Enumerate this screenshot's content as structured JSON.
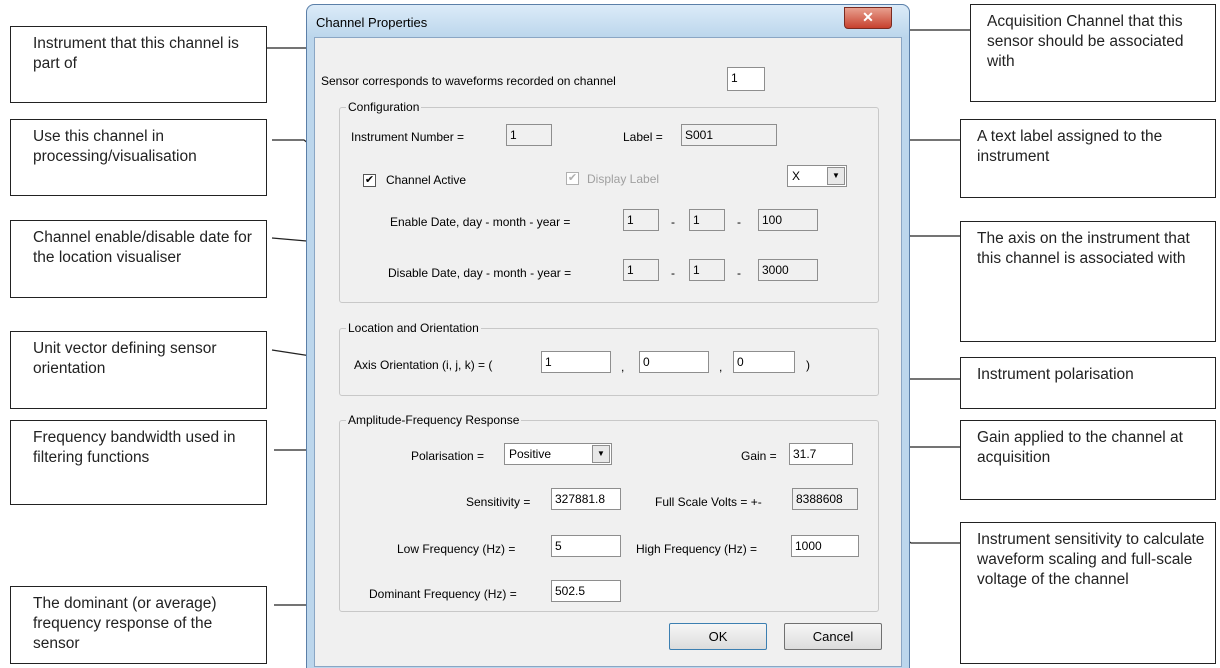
{
  "dialog": {
    "title": "Channel Properties",
    "close_glyph": "✕",
    "sensor_channel_label": "Sensor corresponds to waveforms recorded on channel",
    "sensor_channel_value": "1",
    "configuration": {
      "title": "Configuration",
      "instrument_number_label": "Instrument Number =",
      "instrument_number_value": "1",
      "label_label": "Label =",
      "label_value": "S001",
      "channel_active_label": "Channel Active",
      "channel_active_checked": true,
      "display_label_label": "Display Label",
      "display_label_checked": true,
      "axis_value": "X",
      "enable_date_label": "Enable Date, day - month - year =",
      "enable_day": "1",
      "enable_month": "1",
      "enable_year": "100",
      "disable_date_label": "Disable Date, day - month - year =",
      "disable_day": "1",
      "disable_month": "1",
      "disable_year": "3000",
      "date_sep": "-"
    },
    "location": {
      "title": "Location and Orientation",
      "axis_orientation_label": "Axis Orientation (i, j, k) = (",
      "i": "1",
      "j": "0",
      "k": "0",
      "comma": ",",
      "close_paren": ")"
    },
    "amplitude": {
      "title": "Amplitude-Frequency Response",
      "polarisation_label": "Polarisation =",
      "polarisation_value": "Positive",
      "gain_label": "Gain =",
      "gain_value": "31.7",
      "sensitivity_label": "Sensitivity =",
      "sensitivity_value": "327881.8",
      "full_scale_label": "Full Scale Volts = +-",
      "full_scale_value": "8388608",
      "low_freq_label": "Low Frequency (Hz) =",
      "low_freq_value": "5",
      "high_freq_label": "High Frequency (Hz) =",
      "high_freq_value": "1000",
      "dominant_freq_label": "Dominant Frequency (Hz) =",
      "dominant_freq_value": "502.5"
    },
    "ok_label": "OK",
    "cancel_label": "Cancel"
  },
  "callouts": {
    "instrument": "Instrument that this channel is part of",
    "active": "Use this channel in processing/visualisation",
    "dates": "Channel enable/disable date for the location visualiser",
    "orientation": "Unit vector defining sensor orientation",
    "bandwidth": "Frequency bandwidth used in filtering functions",
    "dominant": "The dominant (or average) frequency response of the sensor",
    "acq_channel": "Acquisition Channel that this sensor should be associated with",
    "text_label": "A text label assigned to the instrument",
    "axis": "The axis on the instrument that this channel is associated with",
    "polarisation": "Instrument polarisation",
    "gain": "Gain applied to the channel at acquisition",
    "sensitivity": "Instrument sensitivity to calculate waveform scaling and full-scale voltage of the channel"
  },
  "colors": {
    "title_bar": "#bcd6ec",
    "client_bg": "#f0f0f0",
    "close_button": "#c7412e"
  }
}
